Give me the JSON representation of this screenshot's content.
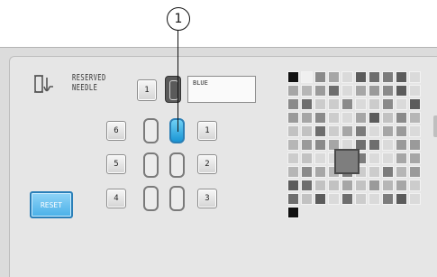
{
  "callout": {
    "label": "1"
  },
  "reserved": {
    "label_line1": "RESERVED",
    "label_line2": "NEEDLE",
    "needle_number": "1",
    "color_name": "BLUE"
  },
  "needle_buttons": [
    {
      "id": "6",
      "label": "6"
    },
    {
      "id": "5",
      "label": "5"
    },
    {
      "id": "4",
      "label": "4"
    },
    {
      "id": "1",
      "label": "1"
    },
    {
      "id": "2",
      "label": "2"
    },
    {
      "id": "3",
      "label": "3"
    }
  ],
  "active_needle": "1",
  "reset_label": "RESET",
  "palette": {
    "colors": {
      "accent_blue": "#1a95d4",
      "selected_border": "#4a4a4a"
    }
  }
}
